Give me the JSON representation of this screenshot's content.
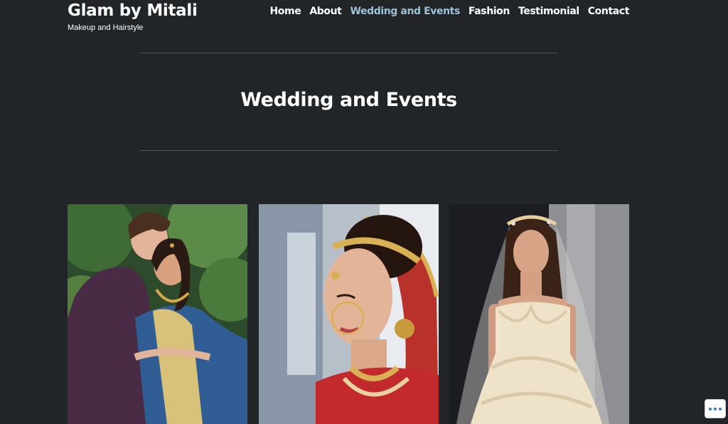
{
  "site": {
    "title": "Glam by Mitali",
    "tagline": "Makeup and Hairstyle"
  },
  "nav": {
    "items": [
      {
        "label": "Home",
        "active": false
      },
      {
        "label": "About",
        "active": false
      },
      {
        "label": "Wedding and Events",
        "active": true
      },
      {
        "label": "Fashion",
        "active": false
      },
      {
        "label": "Testimonial",
        "active": false
      },
      {
        "label": "Contact",
        "active": false
      }
    ],
    "active_color": "#9fc2d8"
  },
  "page": {
    "title": "Wedding and Events",
    "background": "#212528"
  },
  "gallery": {
    "images": [
      {
        "name": "couple-photo"
      },
      {
        "name": "bride-closeup-photo"
      },
      {
        "name": "bride-gown-photo"
      }
    ]
  },
  "actions": {
    "more_icon": "ellipsis-icon"
  }
}
